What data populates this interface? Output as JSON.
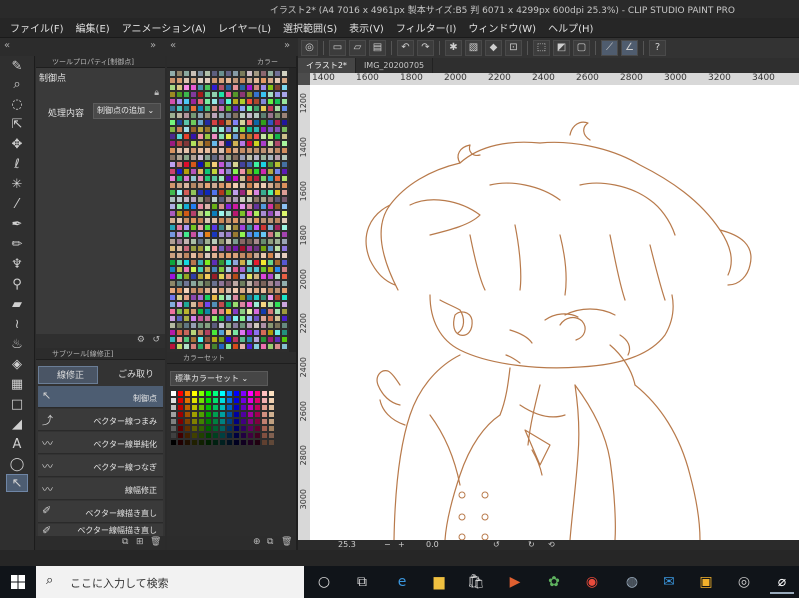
{
  "window": {
    "title": "イラスト2* (A4 7016 x 4961px 製本サイズ:B5 判 6071 x 4299px 600dpi 25.3%) - CLIP STUDIO PAINT PRO"
  },
  "menu": [
    "ファイル(F)",
    "編集(E)",
    "アニメーション(A)",
    "レイヤー(L)",
    "選択範囲(S)",
    "表示(V)",
    "フィルター(I)",
    "ウィンドウ(W)",
    "ヘルプ(H)"
  ],
  "tool_property": {
    "header": "ツールプロパティ[制御点]",
    "tool_name": "制御点",
    "param_label": "処理内容",
    "param_value": "制御点の追加"
  },
  "sub_tool": {
    "header": "サブツール[線修正]",
    "tabs": [
      "線修正",
      "ごみ取り"
    ],
    "items": [
      "制御点",
      "ベクター線つまみ",
      "ベクター線単純化",
      "ベクター線つなぎ",
      "線幅修正",
      "ベクター線描き直し",
      "ベクター線幅描き直し"
    ]
  },
  "color_palette": {
    "header": "カラー"
  },
  "color_set": {
    "header": "カラーセット",
    "selected": "標準カラーセット"
  },
  "documents": {
    "tabs": [
      "イラスト2*",
      "IMG_20200705"
    ]
  },
  "ruler": {
    "horizontal": [
      "1400",
      "1600",
      "1800",
      "2000",
      "2200",
      "2400",
      "2600",
      "2800",
      "3000",
      "3200",
      "3400"
    ],
    "vertical": [
      "1200",
      "1400",
      "1600",
      "1800",
      "2000",
      "2200",
      "2400",
      "2600",
      "2800",
      "3000"
    ]
  },
  "status": {
    "zoom": "25.3",
    "angle": "0.0"
  },
  "taskbar": {
    "search_placeholder": "ここに入力して検索"
  },
  "colors": {
    "line_art": "#b87a4b",
    "selection": "#4d5d72",
    "panel": "#3a3a3a"
  },
  "icons": [
    "pen-icon",
    "search-icon",
    "move-icon",
    "lasso-icon",
    "wand-icon",
    "eyedropper-icon",
    "brush-icon",
    "eraser-icon",
    "fill-icon",
    "text-icon",
    "balloon-icon",
    "control-point-icon"
  ]
}
